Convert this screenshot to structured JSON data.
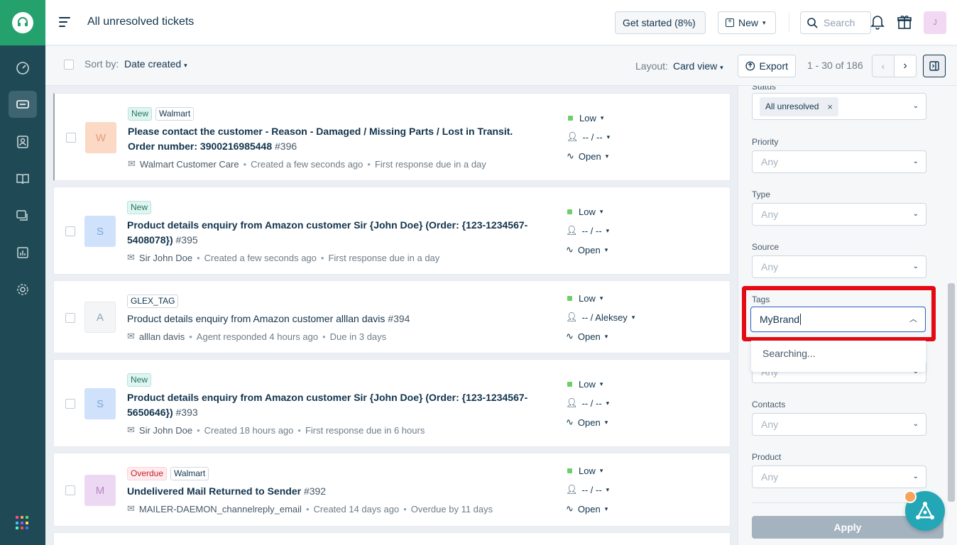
{
  "header": {
    "title": "All unresolved tickets",
    "get_started": "Get started (8%)",
    "new_label": "New",
    "search_placeholder": "Search",
    "avatar_initial": "J"
  },
  "toolbar": {
    "sort_by_label": "Sort by:",
    "sort_by_value": "Date created",
    "layout_label": "Layout:",
    "layout_value": "Card view",
    "export_label": "Export",
    "page_count": "1 - 30 of 186"
  },
  "tickets": [
    {
      "initial": "W",
      "avatar_color": "#fbd9c4",
      "avatar_text": "#e29e78",
      "badges": [
        {
          "text": "New",
          "kind": "new"
        },
        {
          "text": "Walmart",
          "kind": "tag"
        }
      ],
      "subject": "Please contact the customer - Reason - Damaged / Missing Parts / Lost in Transit. Order number: 3900216985448",
      "number": "#396",
      "requester": "Walmart Customer Care",
      "created": "Created a few seconds ago",
      "due": "First response due in a day",
      "priority": "Low",
      "assignee": "-- / --",
      "status": "Open"
    },
    {
      "initial": "S",
      "avatar_color": "#cfe1fb",
      "avatar_text": "#7fa4d6",
      "badges": [
        {
          "text": "New",
          "kind": "new"
        }
      ],
      "subject": "Product details enquiry from Amazon customer Sir {John Doe} (Order: {123-1234567-5408078})",
      "number": "#395",
      "requester": "Sir John Doe",
      "created": "Created a few seconds ago",
      "due": "First response due in a day",
      "priority": "Low",
      "assignee": "-- / --",
      "status": "Open"
    },
    {
      "initial": "A",
      "avatar_color": "#ebeff3",
      "avatar_text": "#92a2b1",
      "badges": [
        {
          "text": "GLEX_TAG",
          "kind": "tag"
        }
      ],
      "subject": "Product details enquiry from Amazon customer alllan davis",
      "number": "#394",
      "requester": "alllan davis",
      "created": "Agent responded 4 hours ago",
      "due": "Due in 3 days",
      "priority": "Low",
      "assignee": "-- / Aleksey",
      "status": "Open"
    },
    {
      "initial": "S",
      "avatar_color": "#cfe1fb",
      "avatar_text": "#7fa4d6",
      "badges": [
        {
          "text": "New",
          "kind": "new"
        }
      ],
      "subject": "Product details enquiry from Amazon customer Sir {John Doe} (Order: {123-1234567-5650646})",
      "number": "#393",
      "requester": "Sir John Doe",
      "created": "Created 18 hours ago",
      "due": "First response due in 6 hours",
      "priority": "Low",
      "assignee": "-- / --",
      "status": "Open"
    },
    {
      "initial": "M",
      "avatar_color": "#ecd8f3",
      "avatar_text": "#b787c2",
      "badges": [
        {
          "text": "Overdue",
          "kind": "overdue"
        },
        {
          "text": "Walmart",
          "kind": "tag"
        }
      ],
      "subject": "Undelivered Mail Returned to Sender",
      "number": "#392",
      "requester": "MAILER-DAEMON_channelreply_email",
      "created": "Created 14 days ago",
      "due": "Overdue by 11 days",
      "priority": "Low",
      "assignee": "-- / --",
      "status": "Open"
    }
  ],
  "filters": {
    "status_label": "Status",
    "status_chip": "All unresolved",
    "priority_label": "Priority",
    "priority_value": "Any",
    "type_label": "Type",
    "type_value": "Any",
    "source_label": "Source",
    "source_value": "Any",
    "tags_label": "Tags",
    "tags_input": "MyBrand",
    "tags_dropdown": "Searching...",
    "hidden_value": "Any",
    "contacts_label": "Contacts",
    "contacts_value": "Any",
    "product_label": "Product",
    "product_value": "Any",
    "apply_label": "Apply"
  },
  "colors": {
    "nav_bg": "#1f4a55",
    "logo_bg": "#25a16e",
    "highlight": "#e20b14",
    "apply_disabled": "#a4b3bf"
  }
}
